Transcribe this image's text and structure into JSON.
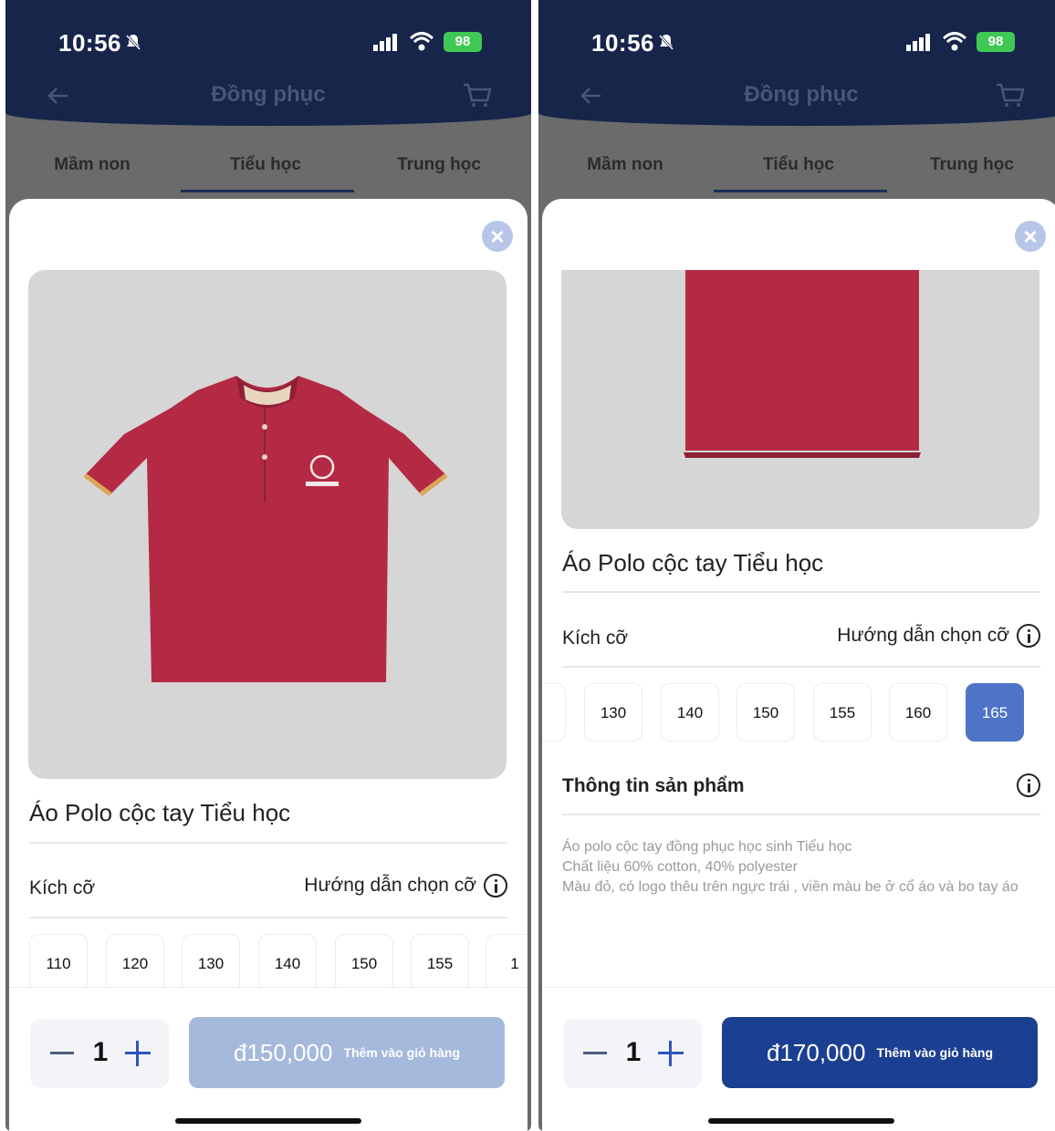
{
  "colors": {
    "nav_bg": "#17254b",
    "accent": "#1c4091",
    "selected_size": "#4e74c8",
    "disabled_button": "#a5b9dd",
    "shirt": "#b42a44",
    "battery": "#3fc954"
  },
  "status_bar": {
    "time": "10:56",
    "battery": "98",
    "icons": [
      "bell-slash-icon",
      "cellular-signal-icon",
      "wifi-icon",
      "battery-icon"
    ]
  },
  "nav": {
    "title": "Đồng phục",
    "icons": [
      "back-arrow-icon",
      "cart-icon"
    ]
  },
  "tabs": [
    {
      "label": "Mầm non"
    },
    {
      "label": "Tiểu học",
      "active": true
    },
    {
      "label": "Trung học"
    }
  ],
  "screens": [
    {
      "product_name": "Áo Polo cộc tay Tiểu học",
      "size_label": "Kích cỡ",
      "size_guide": "Hướng dẫn chọn cỡ",
      "sizes": [
        "110",
        "120",
        "130",
        "140",
        "150",
        "155",
        "1"
      ],
      "quantity": "1",
      "price": "đ150,000",
      "add_to_cart": "Thêm vào giỏ hàng"
    },
    {
      "product_name": "Áo Polo cộc tay Tiểu học",
      "size_label": "Kích cỡ",
      "size_guide": "Hướng dẫn chọn cỡ",
      "sizes": [
        "130",
        "140",
        "150",
        "155",
        "160",
        "165"
      ],
      "selected_size": "165",
      "info_title": "Thông tin sản phẩm",
      "description": [
        "Áo polo cộc tay đồng phục học sinh Tiểu học",
        "Chất liệu 60% cotton, 40% polyester",
        "Màu đỏ, có logo thêu trên ngực trái , viền màu be ở cổ áo và bo tay áo"
      ],
      "quantity": "1",
      "price": "đ170,000",
      "add_to_cart": "Thêm vào giỏ hàng"
    }
  ]
}
